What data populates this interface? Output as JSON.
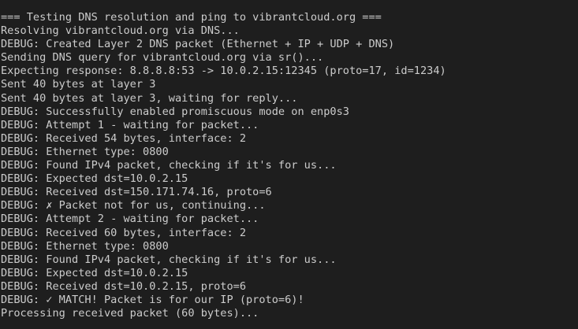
{
  "terminal": {
    "text_color": "#cccccc",
    "background_color": "#1e1e1e",
    "lines": [
      "=== Testing DNS resolution and ping to vibrantcloud.org ===",
      "Resolving vibrantcloud.org via DNS...",
      "DEBUG: Created Layer 2 DNS packet (Ethernet + IP + UDP + DNS)",
      "Sending DNS query for vibrantcloud.org via sr()...",
      "Expecting response: 8.8.8.8:53 -> 10.0.2.15:12345 (proto=17, id=1234)",
      "Sent 40 bytes at layer 3",
      "Sent 40 bytes at layer 3, waiting for reply...",
      "DEBUG: Successfully enabled promiscuous mode on enp0s3",
      "DEBUG: Attempt 1 - waiting for packet...",
      "DEBUG: Received 54 bytes, interface: 2",
      "DEBUG: Ethernet type: 0800",
      "DEBUG: Found IPv4 packet, checking if it's for us...",
      "DEBUG: Expected dst=10.0.2.15",
      "DEBUG: Received dst=150.171.74.16, proto=6",
      "DEBUG: ✗ Packet not for us, continuing...",
      "DEBUG: Attempt 2 - waiting for packet...",
      "DEBUG: Received 60 bytes, interface: 2",
      "DEBUG: Ethernet type: 0800",
      "DEBUG: Found IPv4 packet, checking if it's for us...",
      "DEBUG: Expected dst=10.0.2.15",
      "DEBUG: Received dst=10.0.2.15, proto=6",
      "DEBUG: ✓ MATCH! Packet is for our IP (proto=6)!",
      "Processing received packet (60 bytes)..."
    ]
  }
}
